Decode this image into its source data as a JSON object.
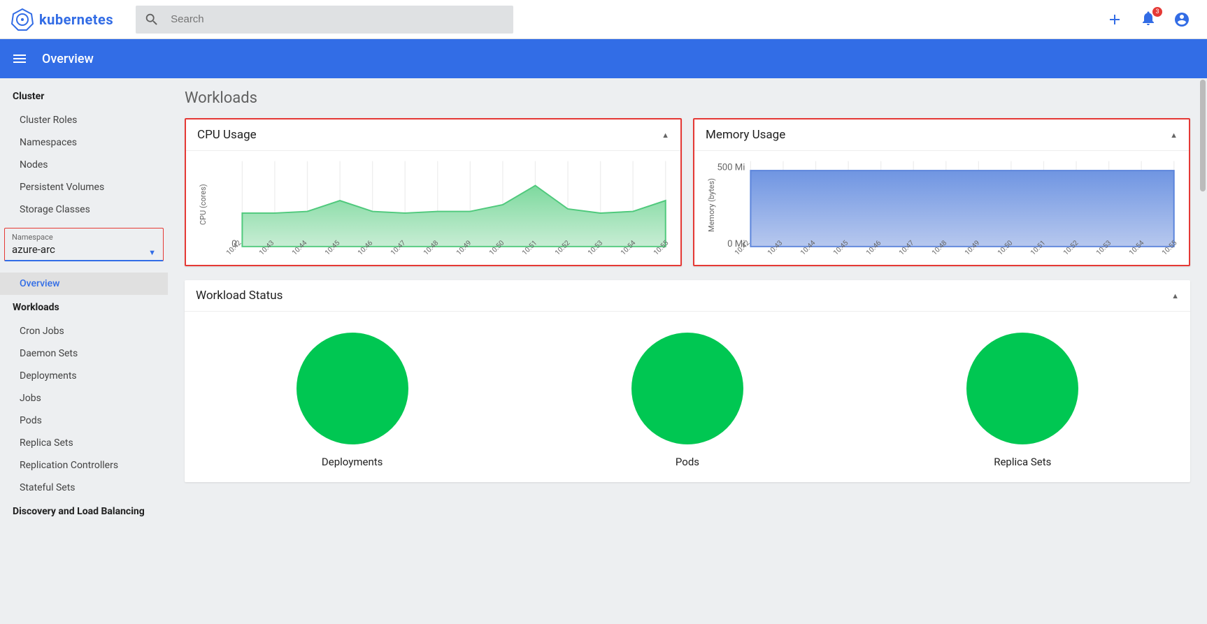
{
  "brand": "kubernetes",
  "search": {
    "placeholder": "Search"
  },
  "notification_count": "3",
  "page_title": "Overview",
  "main_title": "Workloads",
  "namespace": {
    "label": "Namespace",
    "value": "azure-arc"
  },
  "sidebar": {
    "cluster_header": "Cluster",
    "cluster_items": [
      "Cluster Roles",
      "Namespaces",
      "Nodes",
      "Persistent Volumes",
      "Storage Classes"
    ],
    "overview_item": "Overview",
    "workloads_header": "Workloads",
    "workloads_items": [
      "Cron Jobs",
      "Daemon Sets",
      "Deployments",
      "Jobs",
      "Pods",
      "Replica Sets",
      "Replication Controllers",
      "Stateful Sets"
    ],
    "discovery_header": "Discovery and Load Balancing"
  },
  "cards": {
    "cpu_title": "CPU Usage",
    "memory_title": "Memory Usage",
    "workload_status_title": "Workload Status"
  },
  "workload_status": {
    "items": [
      "Deployments",
      "Pods",
      "Replica Sets"
    ]
  },
  "chart_data": [
    {
      "type": "area",
      "title": "CPU Usage",
      "ylabel": "CPU (cores)",
      "y_ticks": [
        "0"
      ],
      "x": [
        "10:42",
        "10:43",
        "10:44",
        "10:45",
        "10:46",
        "10:47",
        "10:48",
        "10:49",
        "10:50",
        "10:51",
        "10:52",
        "10:53",
        "10:54",
        "10:55"
      ],
      "values": [
        0.4,
        0.4,
        0.42,
        0.55,
        0.42,
        0.4,
        0.42,
        0.42,
        0.5,
        0.73,
        0.45,
        0.4,
        0.42,
        0.55
      ],
      "ylim": [
        0,
        1
      ],
      "color_fill_top": "#7dd99e",
      "color_fill_bottom": "#c8edd4",
      "color_stroke": "#4fc97c"
    },
    {
      "type": "area",
      "title": "Memory Usage",
      "ylabel": "Memory (bytes)",
      "y_ticks": [
        "500 Mi",
        "0 Mi"
      ],
      "x": [
        "10:42",
        "10:43",
        "10:44",
        "10:45",
        "10:46",
        "10:47",
        "10:48",
        "10:49",
        "10:50",
        "10:51",
        "10:52",
        "10:53",
        "10:54",
        "10:55"
      ],
      "values": [
        500,
        500,
        500,
        500,
        500,
        500,
        500,
        500,
        500,
        500,
        500,
        500,
        500,
        500
      ],
      "ylim": [
        0,
        550
      ],
      "color_fill_top": "#6f95e2",
      "color_fill_bottom": "#b7c8ee",
      "color_stroke": "#5b84db"
    }
  ]
}
